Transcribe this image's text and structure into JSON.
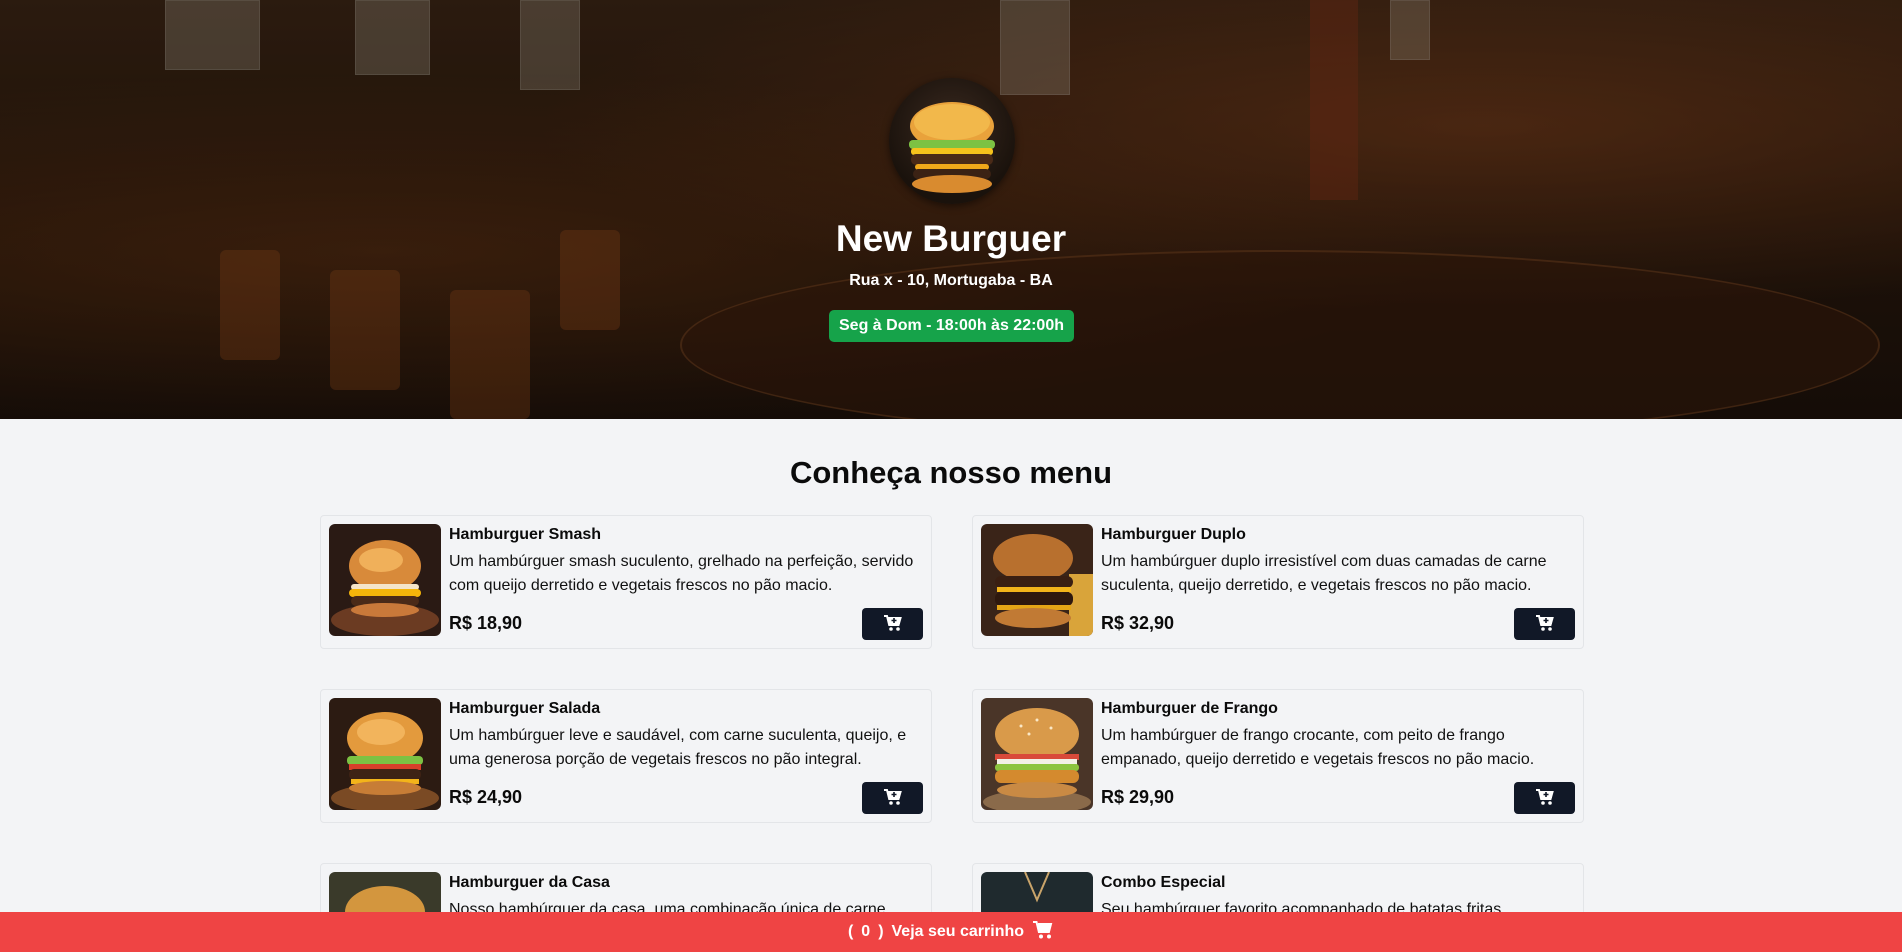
{
  "header": {
    "restaurant_name": "New Burguer",
    "address": "Rua x - 10, Mortugaba - BA",
    "hours": "Seg à Dom - 18:00h às 22:00h",
    "hours_badge_color": "#16a34a",
    "logo_icon": "burger-logo-icon"
  },
  "menu": {
    "title": "Conheça nosso menu",
    "items": [
      {
        "name": "Hamburguer Smash",
        "description": "Um hambúrguer smash suculento, grelhado na perfeição, servido com queijo derretido e vegetais frescos no pão macio.",
        "price": "R$ 18,90",
        "image": "burger-smash-image"
      },
      {
        "name": "Hamburguer Duplo",
        "description": "Um hambúrguer duplo irresistível com duas camadas de carne suculenta, queijo derretido, e vegetais frescos no pão macio.",
        "price": "R$ 32,90",
        "image": "burger-double-image"
      },
      {
        "name": "Hamburguer Salada",
        "description": "Um hambúrguer leve e saudável, com carne suculenta, queijo, e uma generosa porção de vegetais frescos no pão integral.",
        "price": "R$ 24,90",
        "image": "burger-salad-image"
      },
      {
        "name": "Hamburguer de Frango",
        "description": "Um hambúrguer de frango crocante, com peito de frango empanado, queijo derretido e vegetais frescos no pão macio.",
        "price": "R$ 29,90",
        "image": "burger-chicken-image"
      },
      {
        "name": "Hamburguer da Casa",
        "description": "Nosso hambúrguer da casa, uma combinação única de carne",
        "price": "",
        "image": "burger-house-image"
      },
      {
        "name": "Combo Especial",
        "description": "Seu hambúrguer favorito acompanhado de batatas fritas crocantes",
        "price": "",
        "image": "combo-special-image"
      }
    ],
    "cart_button_icon": "cart-plus-icon",
    "cart_button_color": "#111827"
  },
  "cart_bar": {
    "open_paren": "(",
    "count": "0",
    "close_paren": ")",
    "label": "Veja seu carrinho",
    "icon": "cart-icon",
    "color": "#ef4444"
  }
}
